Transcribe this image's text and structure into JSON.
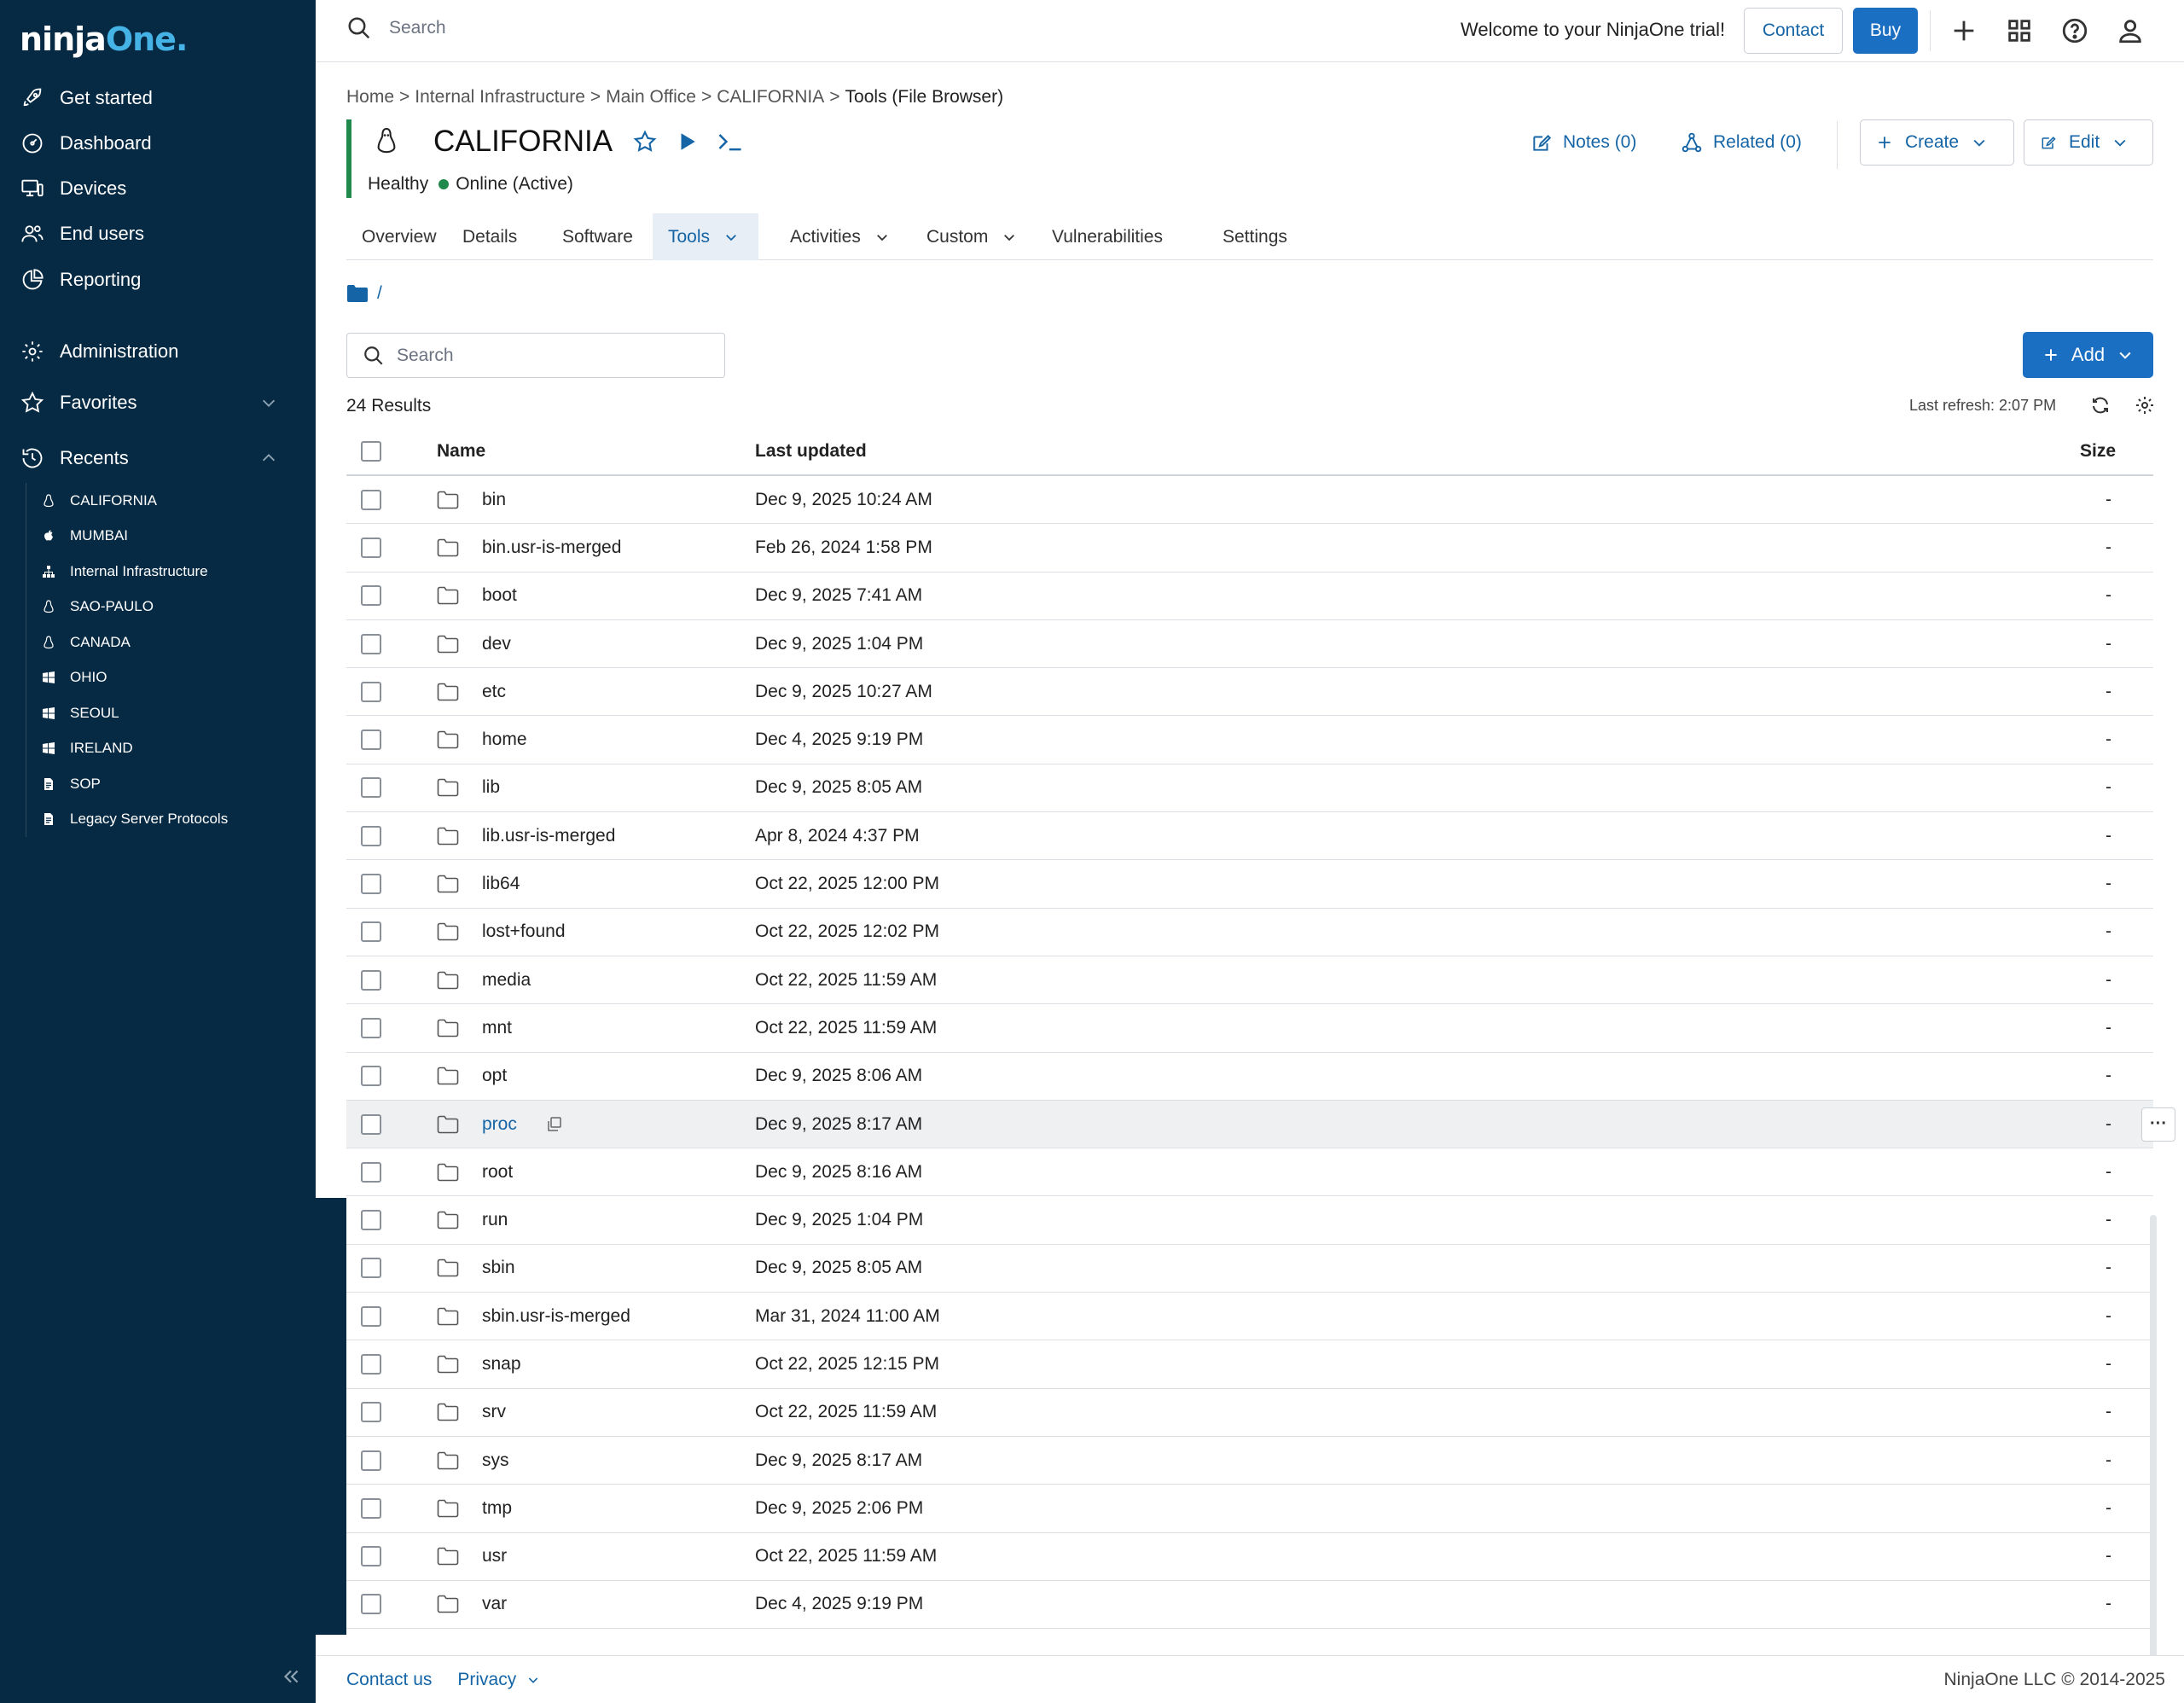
{
  "sidebar": {
    "logo_white": "ninja",
    "logo_blue": "One.",
    "nav": [
      {
        "label": "Get started",
        "icon": "rocket-icon"
      },
      {
        "label": "Dashboard",
        "icon": "gauge-icon"
      },
      {
        "label": "Devices",
        "icon": "devices-icon"
      },
      {
        "label": "End users",
        "icon": "users-icon"
      },
      {
        "label": "Reporting",
        "icon": "chart-pie-icon"
      },
      {
        "label": "Administration",
        "icon": "gear-icon"
      },
      {
        "label": "Favorites",
        "icon": "star-icon"
      },
      {
        "label": "Recents",
        "icon": "history-icon"
      }
    ],
    "recents": [
      {
        "label": "CALIFORNIA",
        "icon": "linux-icon"
      },
      {
        "label": "MUMBAI",
        "icon": "apple-icon"
      },
      {
        "label": "Internal Infrastructure",
        "icon": "org-icon"
      },
      {
        "label": "SAO-PAULO",
        "icon": "linux-icon"
      },
      {
        "label": "CANADA",
        "icon": "linux-icon"
      },
      {
        "label": "OHIO",
        "icon": "windows-icon"
      },
      {
        "label": "SEOUL",
        "icon": "windows-icon"
      },
      {
        "label": "IRELAND",
        "icon": "windows-icon"
      },
      {
        "label": "SOP",
        "icon": "document-icon"
      },
      {
        "label": "Legacy Server Protocols",
        "icon": "document-icon"
      }
    ]
  },
  "topbar": {
    "search_placeholder": "Search",
    "welcome": "Welcome to your NinjaOne trial!",
    "contact": "Contact",
    "buy": "Buy"
  },
  "breadcrumb": [
    "Home",
    "Internal Infrastructure",
    "Main Office",
    "CALIFORNIA",
    "Tools (File Browser)"
  ],
  "device": {
    "name": "CALIFORNIA",
    "health": "Healthy",
    "online": "Online (Active)",
    "notes": "Notes (0)",
    "related": "Related (0)",
    "create": "Create",
    "edit": "Edit",
    "status_color": "#1f8a4c"
  },
  "tabs": [
    "Overview",
    "Details",
    "Software",
    "Tools",
    "Activities",
    "Custom",
    "Vulnerabilities",
    "Settings"
  ],
  "browser": {
    "path": "/",
    "search_placeholder": "Search",
    "add": "Add",
    "results": "24 Results",
    "last_refresh": "Last refresh: 2:07 PM",
    "columns": {
      "name": "Name",
      "updated": "Last updated",
      "size": "Size"
    },
    "rows": [
      {
        "name": "bin",
        "updated": "Dec 9, 2025 10:24 AM",
        "size": "-"
      },
      {
        "name": "bin.usr-is-merged",
        "updated": "Feb 26, 2024 1:58 PM",
        "size": "-"
      },
      {
        "name": "boot",
        "updated": "Dec 9, 2025 7:41 AM",
        "size": "-"
      },
      {
        "name": "dev",
        "updated": "Dec 9, 2025 1:04 PM",
        "size": "-"
      },
      {
        "name": "etc",
        "updated": "Dec 9, 2025 10:27 AM",
        "size": "-"
      },
      {
        "name": "home",
        "updated": "Dec 4, 2025 9:19 PM",
        "size": "-"
      },
      {
        "name": "lib",
        "updated": "Dec 9, 2025 8:05 AM",
        "size": "-"
      },
      {
        "name": "lib.usr-is-merged",
        "updated": "Apr 8, 2024 4:37 PM",
        "size": "-"
      },
      {
        "name": "lib64",
        "updated": "Oct 22, 2025 12:00 PM",
        "size": "-"
      },
      {
        "name": "lost+found",
        "updated": "Oct 22, 2025 12:02 PM",
        "size": "-"
      },
      {
        "name": "media",
        "updated": "Oct 22, 2025 11:59 AM",
        "size": "-"
      },
      {
        "name": "mnt",
        "updated": "Oct 22, 2025 11:59 AM",
        "size": "-"
      },
      {
        "name": "opt",
        "updated": "Dec 9, 2025 8:06 AM",
        "size": "-"
      },
      {
        "name": "proc",
        "updated": "Dec 9, 2025 8:17 AM",
        "size": "-"
      },
      {
        "name": "root",
        "updated": "Dec 9, 2025 8:16 AM",
        "size": "-"
      },
      {
        "name": "run",
        "updated": "Dec 9, 2025 1:04 PM",
        "size": "-"
      },
      {
        "name": "sbin",
        "updated": "Dec 9, 2025 8:05 AM",
        "size": "-"
      },
      {
        "name": "sbin.usr-is-merged",
        "updated": "Mar 31, 2024 11:00 AM",
        "size": "-"
      },
      {
        "name": "snap",
        "updated": "Oct 22, 2025 12:15 PM",
        "size": "-"
      },
      {
        "name": "srv",
        "updated": "Oct 22, 2025 11:59 AM",
        "size": "-"
      },
      {
        "name": "sys",
        "updated": "Dec 9, 2025 8:17 AM",
        "size": "-"
      },
      {
        "name": "tmp",
        "updated": "Dec 9, 2025 2:06 PM",
        "size": "-"
      },
      {
        "name": "usr",
        "updated": "Oct 22, 2025 11:59 AM",
        "size": "-"
      },
      {
        "name": "var",
        "updated": "Dec 4, 2025 9:19 PM",
        "size": "-"
      }
    ]
  },
  "footer": {
    "contact": "Contact us",
    "privacy": "Privacy",
    "copyright": "NinjaOne LLC © 2014-2025"
  }
}
